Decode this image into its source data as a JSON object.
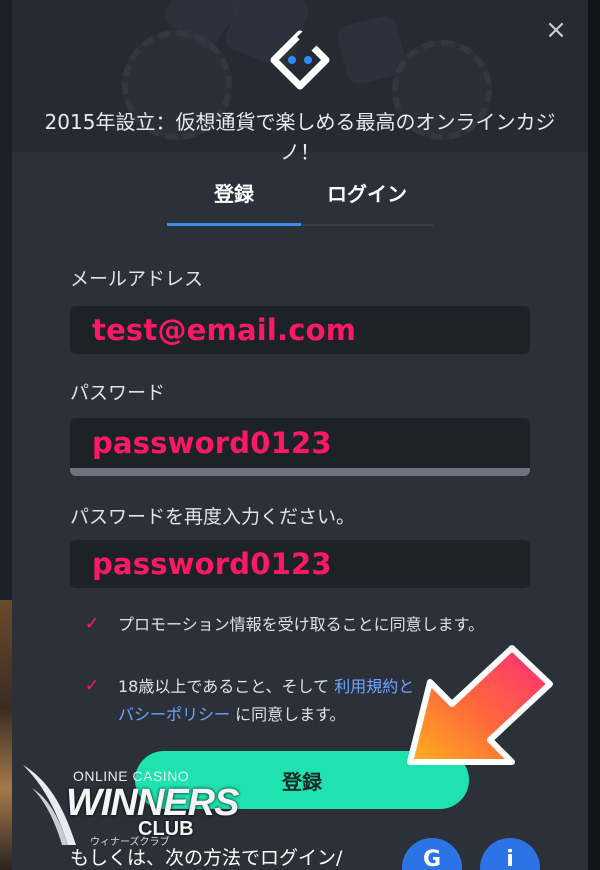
{
  "modal": {
    "tagline": "2015年設立：仮想通貨で楽しめる最高のオンラインカジノ！",
    "close_label": "×",
    "logo_icon": "diamond-face-icon"
  },
  "tabs": [
    {
      "label": "登録",
      "active": true
    },
    {
      "label": "ログイン",
      "active": false
    }
  ],
  "form": {
    "email_label": "メールアドレス",
    "email_value": "test@email.com",
    "password_label": "パスワード",
    "password_value": "password0123",
    "confirm_label": "パスワードを再度入力ください。",
    "confirm_value": "password0123",
    "promo_text": "プロモーション情報を受け取ることに同意します。",
    "age_text_prefix": "18歳以上であること、そして",
    "terms_link": "利用規約と",
    "privacy_link": "バシーポリシー",
    "age_text_suffix": "に同意します。",
    "submit_label": "登録"
  },
  "social": {
    "prompt": "もしくは、次の方法でログイン/",
    "google_icon_text": "G",
    "twitch_icon_text": "ⅰ"
  },
  "watermark": {
    "top": "ONLINE CASINO",
    "main": "WINNERS",
    "club": "CLUB",
    "kana": "ウィナーズクラブ"
  },
  "colors": {
    "accent_green": "#1ee2b0",
    "annotation_pink": "#ff1864",
    "link_blue": "#6fa3ff",
    "tab_indicator": "#3c8eea"
  }
}
